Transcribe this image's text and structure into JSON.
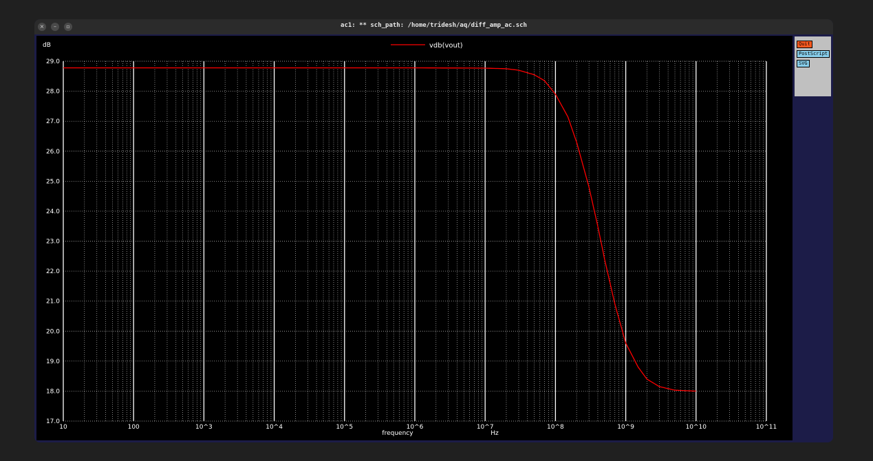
{
  "window": {
    "title": "ac1: ** sch_path: /home/tridesh/aq/diff_amp_ac.sch",
    "controls": [
      {
        "icon": "close-icon",
        "glyph": "×"
      },
      {
        "icon": "minimize-icon",
        "glyph": "–"
      },
      {
        "icon": "restore-icon",
        "glyph": "▫"
      }
    ]
  },
  "side_panel": {
    "quit_label": "Quit",
    "postscript_label": "PostScript",
    "svg_label": "SVG",
    "quit_color": "#ff5a1f",
    "button_color": "#87ceeb"
  },
  "colors": {
    "plot_background": "#000000",
    "grid_major": "#ffffff",
    "grid_minor": "#ffffff",
    "trace": "#ff0000",
    "text": "#ffffff"
  },
  "chart_data": {
    "type": "line",
    "title": "",
    "ylabel": "dB",
    "xlabel": "frequency",
    "xunit": "Hz",
    "xscale": "log",
    "xlim": [
      10,
      100000000000
    ],
    "ylim": [
      17.0,
      29.0
    ],
    "x_tick_values": [
      10,
      100,
      1000,
      10000,
      100000,
      1000000,
      10000000,
      100000000,
      1000000000,
      10000000000,
      100000000000
    ],
    "x_tick_labels": [
      "10",
      "100",
      "10^3",
      "10^4",
      "10^5",
      "10^6",
      "10^7",
      "10^8",
      "10^9",
      "10^10",
      "10^11"
    ],
    "y_tick_values": [
      17,
      18,
      19,
      20,
      21,
      22,
      23,
      24,
      25,
      26,
      27,
      28,
      29
    ],
    "y_tick_labels": [
      "17.0",
      "18.0",
      "19.0",
      "20.0",
      "21.0",
      "22.0",
      "23.0",
      "24.0",
      "25.0",
      "26.0",
      "27.0",
      "28.0",
      "29.0"
    ],
    "grid": true,
    "legend_position": "top-center",
    "series": [
      {
        "name": "vdb(vout)",
        "color": "#ff0000",
        "x": [
          10,
          1000000,
          10000000,
          20000000,
          30000000,
          50000000,
          70000000,
          100000000,
          150000000,
          200000000,
          300000000,
          400000000,
          500000000,
          700000000,
          1000000000,
          1500000000,
          2000000000,
          3000000000,
          5000000000,
          10000000000
        ],
        "y": [
          28.78,
          28.78,
          28.77,
          28.75,
          28.7,
          28.55,
          28.35,
          27.9,
          27.15,
          26.3,
          24.8,
          23.5,
          22.4,
          20.9,
          19.6,
          18.8,
          18.4,
          18.15,
          18.03,
          18.0
        ]
      }
    ]
  }
}
